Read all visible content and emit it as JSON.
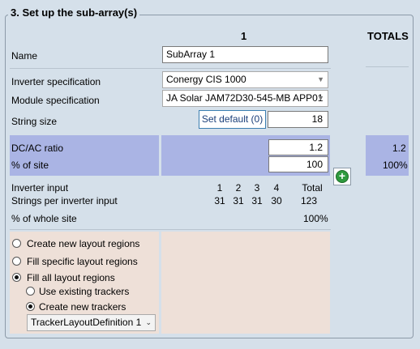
{
  "section_title": "3. Set up the sub-array(s)",
  "columns": {
    "sub_array": "1",
    "totals": "TOTALS"
  },
  "name": {
    "label": "Name",
    "value": "SubArray 1"
  },
  "inverter_spec": {
    "label": "Inverter specification",
    "value": "Conergy CIS 1000"
  },
  "module_spec": {
    "label": "Module specification",
    "value": "JA Solar JAM72D30-545-MB APP01"
  },
  "string_size": {
    "label": "String size",
    "button": "Set default (0)",
    "value": "18"
  },
  "dc_ac": {
    "label": "DC/AC ratio",
    "value": "1.2",
    "total": "1.2"
  },
  "pct_site": {
    "label": "% of site",
    "value": "100",
    "total": "100%"
  },
  "inverter_input": {
    "label": "Inverter input",
    "headers": [
      "1",
      "2",
      "3",
      "4",
      "Total"
    ],
    "strings_label": "Strings per inverter input",
    "strings": [
      "31",
      "31",
      "31",
      "30",
      "123"
    ]
  },
  "pct_whole_site": {
    "label": "% of whole site",
    "value": "100%"
  },
  "layout_options": [
    {
      "label": "Create new layout regions",
      "selected": false
    },
    {
      "label": "Fill specific layout regions",
      "selected": false
    },
    {
      "label": "Fill all layout regions",
      "selected": true
    }
  ],
  "tracker_options": [
    {
      "label": "Use existing trackers",
      "selected": false
    },
    {
      "label": "Create new trackers",
      "selected": true
    }
  ],
  "tracker_layout": {
    "value": "TrackerLayoutDefinition 1"
  },
  "icons": {
    "add": "plus-circle-icon",
    "dropdown": "chevron-down-icon"
  },
  "colors": {
    "background": "#d5e0ea",
    "blue_band": "#aab4e4",
    "peach_band": "#eee0d8",
    "add_green": "#2e9a3e"
  }
}
